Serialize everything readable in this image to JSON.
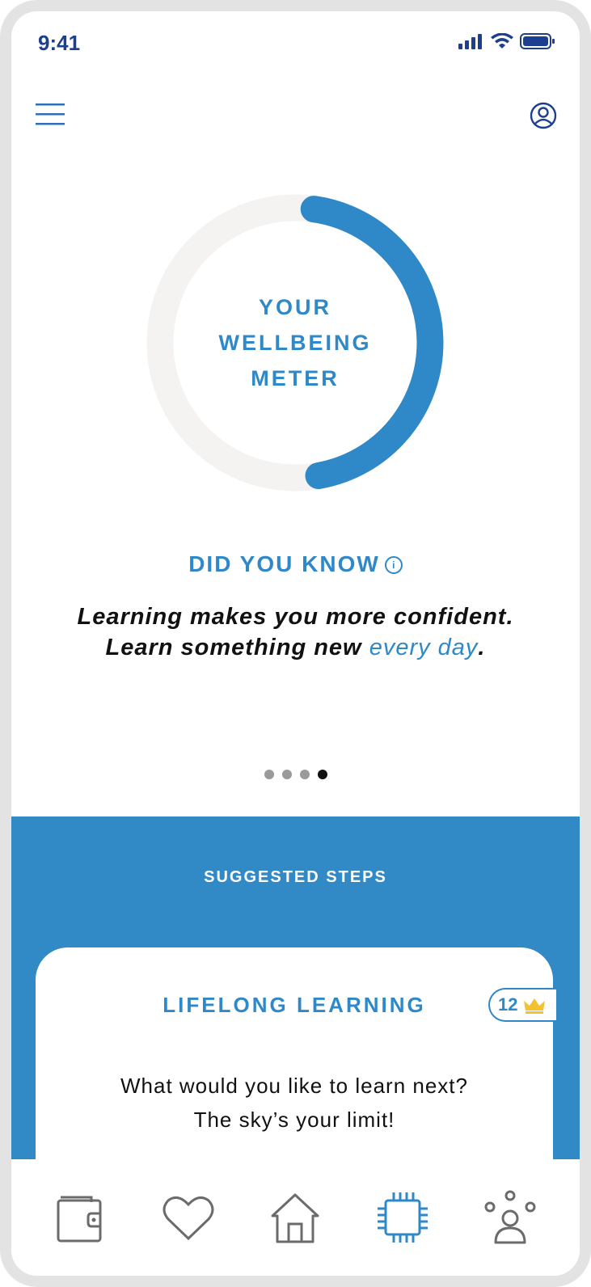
{
  "status_bar": {
    "time": "9:41"
  },
  "meter": {
    "label_line1": "YOUR",
    "label_line2": "WELLBEING",
    "label_line3": "METER",
    "fill_fraction": 0.45,
    "track_color": "#f4f3f1",
    "fill_color": "#2f88c8"
  },
  "did_you_know": {
    "title": "DID YOU KNOW",
    "info_symbol": "i",
    "fact_part1": "Learning makes you more confident. Learn something new",
    "fact_highlight": "every day",
    "fact_end": "."
  },
  "pager": {
    "count": 4,
    "active_index": 3
  },
  "suggested": {
    "title": "SUGGESTED STEPS",
    "card": {
      "title": "LIFELONG LEARNING",
      "badge_value": "12",
      "badge_icon": "crown-icon",
      "text_line1": "What would you like to learn next?",
      "text_line2": "The sky’s your limit!"
    }
  },
  "tabs": [
    {
      "name": "wallet-icon"
    },
    {
      "name": "heart-icon"
    },
    {
      "name": "home-icon"
    },
    {
      "name": "chip-icon",
      "active": true
    },
    {
      "name": "community-icon"
    }
  ],
  "colors": {
    "accent": "#2f88c8",
    "status": "#1d3f8f",
    "inactive_tab": "#6b6b6b"
  }
}
